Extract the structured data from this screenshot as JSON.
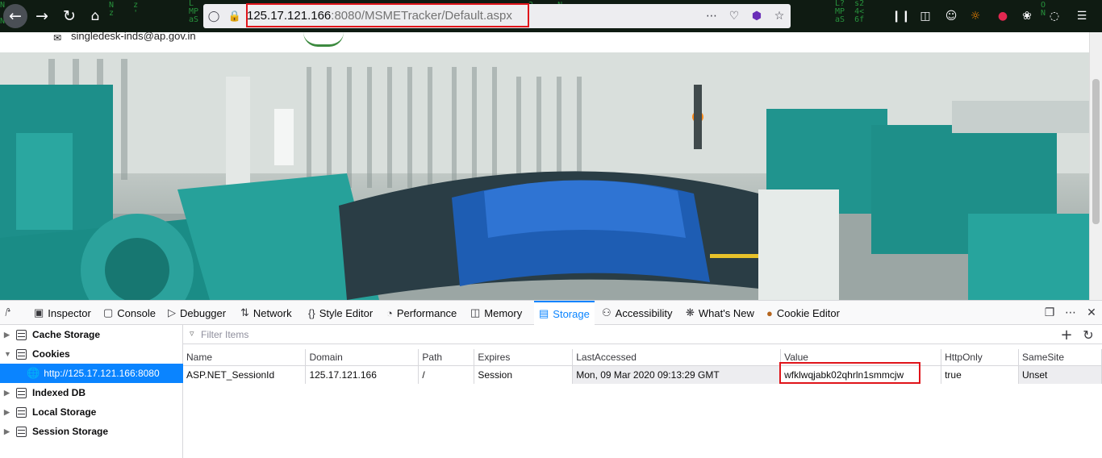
{
  "browser": {
    "url_host": "125.17.121.166",
    "url_rest": ":8080/MSMETracker/Default.aspx",
    "url_more": "⋯",
    "icons": [
      "back-icon",
      "forward-icon",
      "reload-icon",
      "home-icon",
      "tracking-shield-icon",
      "insecure-lock-icon",
      "page-actions-icon",
      "pocket-icon",
      "extension-icon",
      "bookmark-star-icon",
      "library-icon",
      "sidebar-icon",
      "account-icon",
      "menu-icon"
    ]
  },
  "page": {
    "email": "singledesk-inds@ap.gov.in"
  },
  "devtools": {
    "tabs": [
      {
        "label": "Inspector",
        "icon": "inspector-icon"
      },
      {
        "label": "Console",
        "icon": "console-icon"
      },
      {
        "label": "Debugger",
        "icon": "debugger-icon"
      },
      {
        "label": "Network",
        "icon": "network-icon"
      },
      {
        "label": "Style Editor",
        "icon": "style-editor-icon"
      },
      {
        "label": "Performance",
        "icon": "performance-icon"
      },
      {
        "label": "Memory",
        "icon": "memory-icon"
      },
      {
        "label": "Storage",
        "icon": "storage-icon",
        "selected": true
      },
      {
        "label": "Accessibility",
        "icon": "accessibility-icon"
      },
      {
        "label": "What's New",
        "icon": "whats-new-icon"
      },
      {
        "label": "Cookie Editor",
        "icon": "cookie-icon"
      }
    ],
    "sidebar": [
      {
        "label": "Cache Storage",
        "expanded": false
      },
      {
        "label": "Cookies",
        "expanded": true
      },
      {
        "label": "http://125.17.121.166:8080",
        "selected": true
      },
      {
        "label": "Indexed DB",
        "expanded": false
      },
      {
        "label": "Local Storage",
        "expanded": false
      },
      {
        "label": "Session Storage",
        "expanded": false
      }
    ],
    "filter_placeholder": "Filter Items",
    "table": {
      "columns": [
        "Name",
        "Domain",
        "Path",
        "Expires",
        "LastAccessed",
        "Value",
        "HttpOnly",
        "SameSite"
      ],
      "rows": [
        [
          "ASP.NET_SessionId",
          "125.17.121.166",
          "/",
          "Session",
          "Mon, 09 Mar 2020 09:13:29 GMT",
          "wfklwqjabk02qhrln1smmcjw",
          "true",
          "Unset"
        ]
      ]
    }
  },
  "colors": {
    "accent": "#0a84ff",
    "highlight_box": "#e0141a",
    "toolbar_bg": "#0f1b12"
  }
}
